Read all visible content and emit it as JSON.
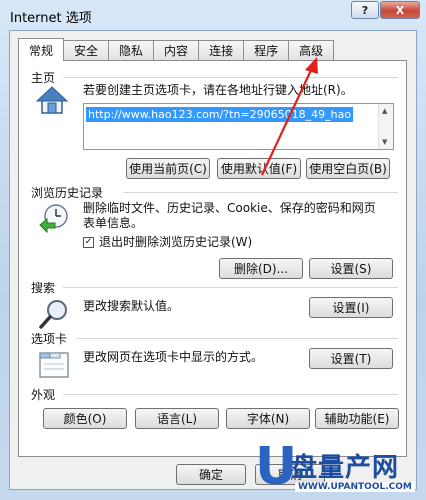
{
  "window": {
    "title": "Internet 选项",
    "help_label": "?",
    "close_label": "X"
  },
  "tabs": [
    {
      "label": "常规"
    },
    {
      "label": "安全"
    },
    {
      "label": "隐私"
    },
    {
      "label": "内容"
    },
    {
      "label": "连接"
    },
    {
      "label": "程序"
    },
    {
      "label": "高级"
    }
  ],
  "homepage": {
    "title": "主页",
    "description": "若要创建主页选项卡，请在各地址行键入地址(R)。",
    "url": "http://www.hao123.com/?tn=29065018_49_hao",
    "use_current": "使用当前页(C)",
    "use_default": "使用默认值(F)",
    "use_blank": "使用空白页(B)"
  },
  "history": {
    "title": "浏览历史记录",
    "description_line1": "删除临时文件、历史记录、Cookie、保存的密码和网页",
    "description_line2": "表单信息。",
    "checkbox_label": "退出时删除浏览历史记录(W)",
    "checkbox_checked": true,
    "delete_button": "删除(D)...",
    "settings_button": "设置(S)"
  },
  "search": {
    "title": "搜索",
    "description": "更改搜索默认值。",
    "settings_button": "设置(I)"
  },
  "tabs_section": {
    "title": "选项卡",
    "description": "更改网页在选项卡中显示的方式。",
    "settings_button": "设置(T)"
  },
  "appearance": {
    "title": "外观",
    "colors_button": "颜色(O)",
    "languages_button": "语言(L)",
    "fonts_button": "字体(N)",
    "accessibility_button": "辅助功能(E)"
  },
  "footer": {
    "ok_button": "确定",
    "cancel_button": "取消"
  },
  "watermark": {
    "logo_letter": "U",
    "logo_text": "盘量产网",
    "site_url": "WWW.UPANTOOL.COM"
  },
  "colors": {
    "selection": "#3399ff",
    "arrow": "#e0201b",
    "watermark_blue": "#1c4d9e"
  }
}
